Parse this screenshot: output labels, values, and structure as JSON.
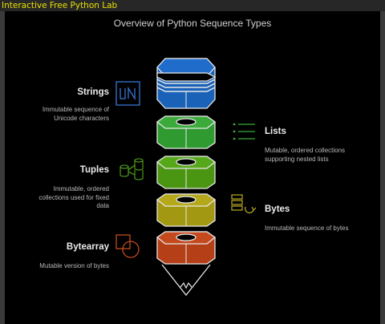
{
  "window": {
    "title": "Interactive Free Python Lab"
  },
  "diagram": {
    "title": "Overview of Python Sequence Types",
    "items": [
      {
        "name": "Strings",
        "description_lines": [
          "Immutable sequence of",
          "Unicode characters"
        ],
        "color": "#1a62b8",
        "icon": "unicode-icon"
      },
      {
        "name": "Lists",
        "description_lines": [
          "Mutable, ordered collections",
          "supporting nested lists"
        ],
        "color": "#2f9a2f",
        "icon": "list-icon"
      },
      {
        "name": "Tuples",
        "description_lines": [
          "Immutable, ordered",
          "collections used for fixed",
          "data"
        ],
        "color": "#4a9512",
        "icon": "cylinders-icon"
      },
      {
        "name": "Bytes",
        "description_lines": [
          "Immutable sequence of bytes"
        ],
        "color": "#a39812",
        "icon": "server-refresh-icon"
      },
      {
        "name": "Bytearray",
        "description_lines": [
          "Mutable version of bytes"
        ],
        "color": "#b53f17",
        "icon": "shapes-icon"
      }
    ]
  }
}
